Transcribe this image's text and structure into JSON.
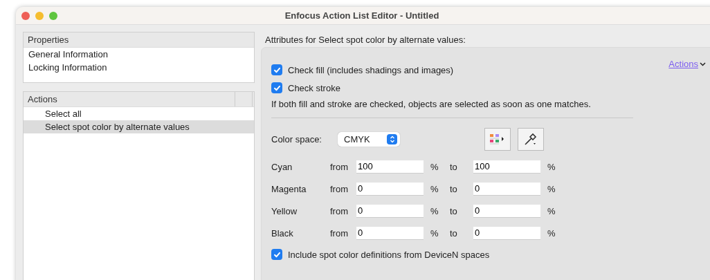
{
  "window": {
    "title": "Enfocus Action List Editor - Untitled"
  },
  "properties": {
    "header": "Properties",
    "items": [
      {
        "label": "General Information",
        "selected": false
      },
      {
        "label": "Locking Information",
        "selected": false
      }
    ]
  },
  "actions": {
    "header": "Actions",
    "items": [
      {
        "label": "Select all",
        "selected": false
      },
      {
        "label": "Select spot color by alternate values",
        "selected": true
      }
    ]
  },
  "attributes": {
    "heading": "Attributes for Select spot color by alternate values:",
    "actions_link": "Actions",
    "checks": [
      {
        "label": "Check fill (includes shadings and images)",
        "checked": true
      },
      {
        "label": "Check stroke",
        "checked": true
      }
    ],
    "note": "If both fill and stroke are checked, objects are selected as soon as one matches.",
    "color_space": {
      "label": "Color space:",
      "value": "CMYK"
    },
    "channels": [
      {
        "name": "Cyan",
        "from_label": "from",
        "from": "100",
        "from_unit": "%",
        "to_label": "to",
        "to": "100",
        "to_unit": "%"
      },
      {
        "name": "Magenta",
        "from_label": "from",
        "from": "0",
        "from_unit": "%",
        "to_label": "to",
        "to": "0",
        "to_unit": "%"
      },
      {
        "name": "Yellow",
        "from_label": "from",
        "from": "0",
        "from_unit": "%",
        "to_label": "to",
        "to": "0",
        "to_unit": "%"
      },
      {
        "name": "Black",
        "from_label": "from",
        "from": "0",
        "from_unit": "%",
        "to_label": "to",
        "to": "0",
        "to_unit": "%"
      }
    ],
    "include": {
      "label": "Include spot color definitions from DeviceN spaces",
      "checked": true
    }
  }
}
